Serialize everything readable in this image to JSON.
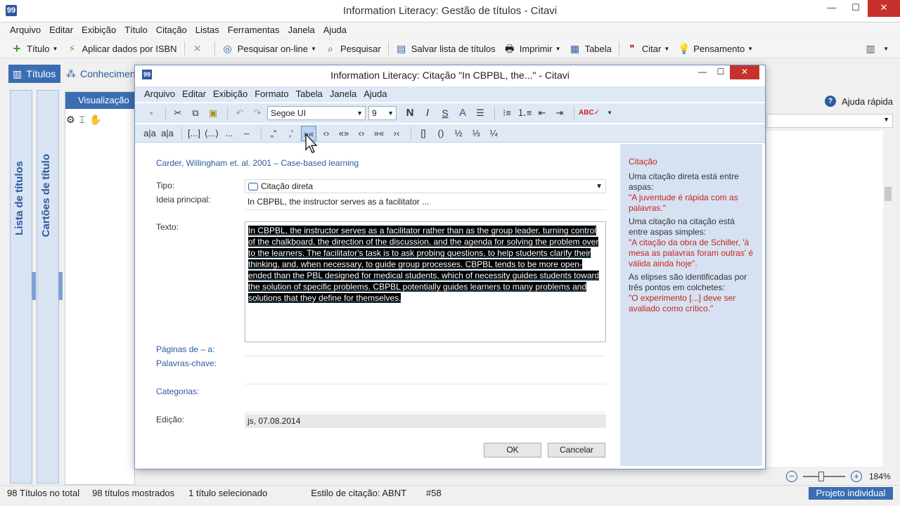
{
  "main_window": {
    "title": "Information Literacy: Gestão de títulos - Citavi",
    "menu": [
      "Arquivo",
      "Editar",
      "Exibição",
      "Título",
      "Citação",
      "Listas",
      "Ferramentas",
      "Janela",
      "Ajuda"
    ],
    "toolbar": {
      "titulo": "Título",
      "apply_isbn": "Aplicar dados por ISBN",
      "search_online": "Pesquisar on-line",
      "search": "Pesquisar",
      "save_list": "Salvar lista de títulos",
      "print": "Imprimir",
      "table": "Tabela",
      "cite": "Citar",
      "thought": "Pensamento"
    },
    "nav": {
      "titles_tab": "Títulos",
      "knowledge_tab": "Conhecimen"
    },
    "side_panels": {
      "title_list": "Lista de títulos",
      "title_cards": "Cartões de título"
    },
    "view_header": "Visualização",
    "quick_help": "Ajuda rápida",
    "zoom": "184%",
    "status": {
      "total": "98 Títulos no total",
      "shown": "98 títulos mostrados",
      "selected": "1 título selecionado",
      "style": "Estilo de citação: ABNT",
      "number": "#58",
      "project": "Projeto individual"
    }
  },
  "dialog": {
    "title": "Information Literacy: Citação \"In CBPBL, the...\" - Citavi",
    "menu": [
      "Arquivo",
      "Editar",
      "Exibição",
      "Formato",
      "Tabela",
      "Janela",
      "Ajuda"
    ],
    "font": "Segoe UI",
    "font_size": "9",
    "tb2_items": [
      "a|a",
      "a|a",
      "[...]",
      "(...)",
      "...",
      "–",
      "„“",
      "‚‘",
      "»«",
      "‹›",
      "«»",
      "‹›",
      "»«",
      "›‹",
      "[]",
      "()",
      "½",
      "⅓",
      "¼"
    ],
    "reference": "Carder, Willingham et. al. 2001 – Case-based learning",
    "labels": {
      "type": "Tipo:",
      "main_idea": "Ideia principal:",
      "text": "Texto:",
      "pages": "Páginas de – a:",
      "keywords": "Palavras-chave:",
      "categories": "Categorias:",
      "edition": "Edição:"
    },
    "type_value": "Citação direta",
    "main_idea_value": "In CBPBL, the instructor serves as a facilitator ...",
    "text_value": "In CBPBL, the instructor serves as a facilitator rather than as the group leader, turning control of the chalkboard, the direction of the discussion, and the agenda for solving the problem over to the learners. The facilitator's task is to ask probing questions, to help students clarify their thinking, and, when necessary, to guide group processes. CBPBL tends to be more open-ended than the PBL designed for medical students, which of necessity guides students toward the solution of specific problems. CBPBL potentially guides learners to many problems and solutions that they define for themselves.",
    "edition_value": "js, 07.08.2014",
    "ok": "OK",
    "cancel": "Cancelar",
    "help": {
      "heading": "Citação",
      "p1": "Uma citação direta está entre aspas:",
      "ex1": "\"A juventude é rápida com as palavras.\"",
      "p2": "Uma citação na citação está entre aspas simples:",
      "ex2": "\"A citação da obra de Schiller, 'à mesa as palavras foram outras' é válida ainda hoje\".",
      "p3": "As elipses são identificadas por três pontos em colchetes:",
      "ex3": "\"O experimento [...] deve ser avaliado como crítico.\""
    }
  },
  "colors": {
    "accent": "#3b6db3",
    "help_red": "#c8241c",
    "dialog_bar": "#dfe8f5"
  }
}
